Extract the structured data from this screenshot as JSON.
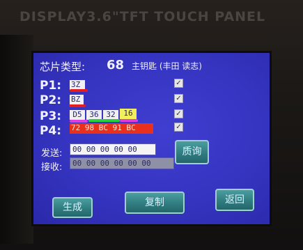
{
  "device": {
    "bezel_title": "DISPLAY3.6\"TFT TOUCH PANEL"
  },
  "header": {
    "chip_type_label": "芯片类型:",
    "chip_type_value": "68",
    "key_label": "主钥匙 (丰田 读志)"
  },
  "rows": [
    {
      "label": "P1:",
      "value": "3Z",
      "checked": true
    },
    {
      "label": "P2:",
      "value": "BZ",
      "checked": true
    },
    {
      "label": "P3:",
      "cells": [
        "D5",
        "36",
        "32",
        "16"
      ],
      "checked": true
    },
    {
      "label": "P4:",
      "value": "72 98 BC 91 BC",
      "checked": true
    }
  ],
  "send": {
    "label": "发送:",
    "value": "00 00 00 00 00"
  },
  "receive": {
    "label": "接收:",
    "value": "00 00 00 00 00 00"
  },
  "buttons": {
    "query": "质询",
    "generate": "生成",
    "copy": "复制",
    "back": "返回"
  },
  "colors": {
    "screen": "#3534c0",
    "button": "#2f7a7e",
    "mark_red": "#e41e1e",
    "mark_green": "#28d23c",
    "mark_magenta": "#e03ce0",
    "highlight_yellow": "#f2ee5c",
    "highlight_red": "#e8301c"
  },
  "icons": {
    "checkbox": "checkmark-icon"
  }
}
